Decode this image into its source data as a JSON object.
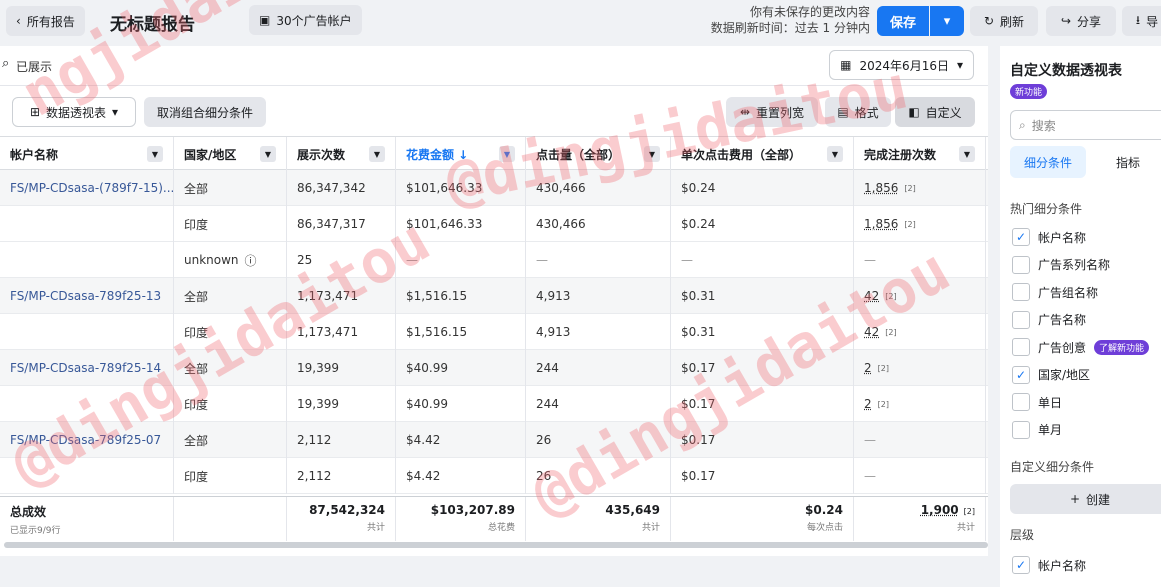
{
  "topbar": {
    "back_label": "所有报告",
    "title": "无标题报告",
    "accounts_label": "30个广告帐户",
    "unsaved_line1": "你有未保存的更改内容",
    "unsaved_line2": "数据刷新时间：过去 1 分钟内",
    "save_label": "保存",
    "refresh_label": "刷新",
    "share_label": "分享",
    "export_label": "导"
  },
  "toolbar": {
    "search_text": "已展示",
    "date_label": "2024年6月16日",
    "pivot_label": "数据透视表",
    "ungroup_label": "取消组合细分条件",
    "reset_width_label": "重置列宽",
    "format_label": "格式",
    "customize_label": "自定义"
  },
  "table": {
    "columns": [
      {
        "label": "帐户名称",
        "sorted": false
      },
      {
        "label": "国家/地区",
        "sorted": false
      },
      {
        "label": "展示次数",
        "sorted": false
      },
      {
        "label": "花费金额 ↓",
        "sorted": true
      },
      {
        "label": "点击量（全部）",
        "sorted": false
      },
      {
        "label": "单次点击费用（全部）",
        "sorted": false
      },
      {
        "label": "完成注册次数",
        "sorted": false
      }
    ],
    "rows": [
      {
        "account": "FS/MP-CDsasa-(789f7-15)...",
        "country": "全部",
        "impressions": "86,347,342",
        "spend": "$101,646.33",
        "clicks": "430,466",
        "cpc": "$0.24",
        "reg": "1,856",
        "reg_sup": "[2]"
      },
      {
        "account": "",
        "country": "印度",
        "impressions": "86,347,317",
        "spend": "$101,646.33",
        "clicks": "430,466",
        "cpc": "$0.24",
        "reg": "1,856",
        "reg_sup": "[2]"
      },
      {
        "account": "",
        "country": "unknown",
        "impressions": "25",
        "spend": "—",
        "clicks": "—",
        "cpc": "—",
        "reg": "—",
        "reg_sup": ""
      },
      {
        "account": "FS/MP-CDsasa-789f25-13",
        "country": "全部",
        "impressions": "1,173,471",
        "spend": "$1,516.15",
        "clicks": "4,913",
        "cpc": "$0.31",
        "reg": "42",
        "reg_sup": "[2]"
      },
      {
        "account": "",
        "country": "印度",
        "impressions": "1,173,471",
        "spend": "$1,516.15",
        "clicks": "4,913",
        "cpc": "$0.31",
        "reg": "42",
        "reg_sup": "[2]"
      },
      {
        "account": "FS/MP-CDsasa-789f25-14",
        "country": "全部",
        "impressions": "19,399",
        "spend": "$40.99",
        "clicks": "244",
        "cpc": "$0.17",
        "reg": "2",
        "reg_sup": "[2]"
      },
      {
        "account": "",
        "country": "印度",
        "impressions": "19,399",
        "spend": "$40.99",
        "clicks": "244",
        "cpc": "$0.17",
        "reg": "2",
        "reg_sup": "[2]"
      },
      {
        "account": "FS/MP-CDsasa-789f25-07",
        "country": "全部",
        "impressions": "2,112",
        "spend": "$4.42",
        "clicks": "26",
        "cpc": "$0.17",
        "reg": "—",
        "reg_sup": ""
      },
      {
        "account": "",
        "country": "印度",
        "impressions": "2,112",
        "spend": "$4.42",
        "clicks": "26",
        "cpc": "$0.17",
        "reg": "—",
        "reg_sup": ""
      }
    ],
    "total": {
      "label": "总成效",
      "sub": "已显示9/9行",
      "impressions": "87,542,324",
      "impressions_sub": "共计",
      "spend": "$103,207.89",
      "spend_sub": "总花费",
      "clicks": "435,649",
      "clicks_sub": "共计",
      "cpc": "$0.24",
      "cpc_sub": "每次点击",
      "reg": "1,900",
      "reg_sup": "[2]",
      "reg_sub": "共计"
    }
  },
  "sidebar": {
    "title": "自定义数据透视表",
    "new_badge": "新功能",
    "search_placeholder": "搜索",
    "tab_breakdowns": "细分条件",
    "tab_metrics": "指标",
    "popular_heading": "热门细分条件",
    "items": [
      {
        "label": "帐户名称",
        "checked": true
      },
      {
        "label": "广告系列名称",
        "checked": false
      },
      {
        "label": "广告组名称",
        "checked": false
      },
      {
        "label": "广告名称",
        "checked": false
      },
      {
        "label": "广告创意",
        "checked": false
      },
      {
        "label": "国家/地区",
        "checked": true
      },
      {
        "label": "单日",
        "checked": false
      },
      {
        "label": "单月",
        "checked": false
      }
    ],
    "learn_badge": "了解新功能",
    "custom_heading": "自定义细分条件",
    "create_label": "创建",
    "levels_heading": "层级",
    "level_item": "帐户名称"
  },
  "watermark": {
    "text1": "ngjidaitou",
    "text2": "@dingjidaitou"
  },
  "colors": {
    "primary": "#1877f2",
    "badge": "#6e3ed8",
    "watermark": "#f0646e"
  }
}
